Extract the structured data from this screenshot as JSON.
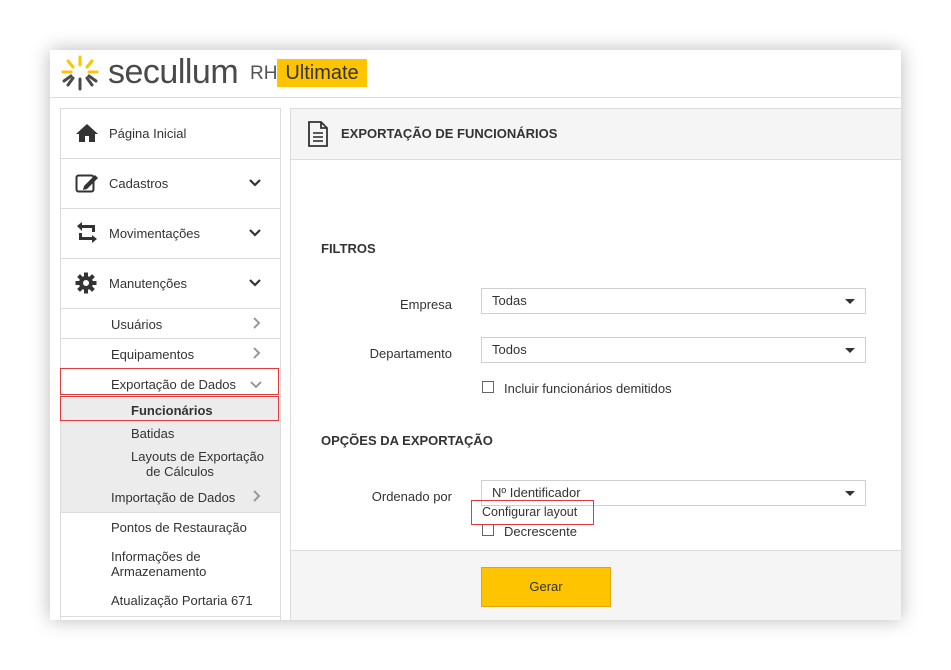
{
  "brand": {
    "name": "secullum",
    "suffix": "RH",
    "badge": "Ultimate",
    "accent": "#ffc400"
  },
  "sidebar": {
    "items": [
      {
        "label": "Página Inicial",
        "icon": "home-icon"
      },
      {
        "label": "Cadastros",
        "icon": "edit-icon"
      },
      {
        "label": "Movimentações",
        "icon": "swap-icon"
      },
      {
        "label": "Manutenções",
        "icon": "gear-icon"
      }
    ],
    "manutencoes_sub": [
      {
        "label": "Usuários"
      },
      {
        "label": "Equipamentos"
      },
      {
        "label": "Exportação de Dados"
      },
      {
        "label": "Importação de Dados"
      },
      {
        "label": "Pontos de Restauração"
      },
      {
        "label": "Informações de",
        "label2": "Armazenamento"
      },
      {
        "label": "Atualização Portaria 671"
      }
    ],
    "exportacao_sub": [
      {
        "label": "Funcionários"
      },
      {
        "label": "Batidas"
      },
      {
        "label": "Layouts de Exportação",
        "label2": "de Cálculos"
      }
    ]
  },
  "main": {
    "title": "EXPORTAÇÃO DE FUNCIONÁRIOS",
    "filtros": {
      "title": "FILTROS",
      "empresa_label": "Empresa",
      "empresa_value": "Todas",
      "departamento_label": "Departamento",
      "departamento_value": "Todos",
      "incluir_label": "Incluir funcionários demitidos"
    },
    "opcoes": {
      "title": "OPÇÕES DA EXPORTAÇÃO",
      "ordenado_label": "Ordenado por",
      "ordenado_value": "Nº Identificador",
      "decrescente_label": "Decrescente",
      "configurar_label": "Configurar layout"
    },
    "gerar_label": "Gerar"
  }
}
